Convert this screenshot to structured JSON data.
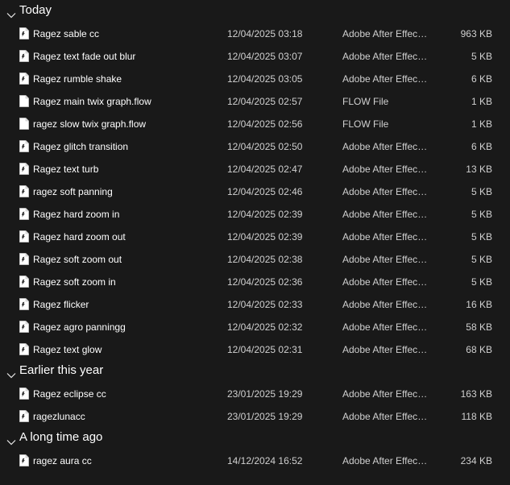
{
  "groups": [
    {
      "title": "Today",
      "files": [
        {
          "name": "Ragez sable cc",
          "date": "12/04/2025 03:18",
          "type": "Adobe After Effects Preset",
          "size": "963 KB",
          "icon": "ffx-icon"
        },
        {
          "name": "Ragez text fade out blur",
          "date": "12/04/2025 03:07",
          "type": "Adobe After Effects Preset",
          "size": "5 KB",
          "icon": "ffx-icon"
        },
        {
          "name": "Ragez rumble shake",
          "date": "12/04/2025 03:05",
          "type": "Adobe After Effects Preset",
          "size": "6 KB",
          "icon": "ffx-icon"
        },
        {
          "name": "Ragez main twix graph.flow",
          "date": "12/04/2025 02:57",
          "type": "FLOW File",
          "size": "1 KB",
          "icon": "file-icon"
        },
        {
          "name": "ragez slow twix graph.flow",
          "date": "12/04/2025 02:56",
          "type": "FLOW File",
          "size": "1 KB",
          "icon": "file-icon"
        },
        {
          "name": "Ragez glitch transition",
          "date": "12/04/2025 02:50",
          "type": "Adobe After Effects Preset",
          "size": "6 KB",
          "icon": "ffx-icon"
        },
        {
          "name": "Ragez text turb",
          "date": "12/04/2025 02:47",
          "type": "Adobe After Effects Preset",
          "size": "13 KB",
          "icon": "ffx-icon"
        },
        {
          "name": "ragez soft panning",
          "date": "12/04/2025 02:46",
          "type": "Adobe After Effects Preset",
          "size": "5 KB",
          "icon": "ffx-icon"
        },
        {
          "name": "Ragez hard zoom in",
          "date": "12/04/2025 02:39",
          "type": "Adobe After Effects Preset",
          "size": "5 KB",
          "icon": "ffx-icon"
        },
        {
          "name": "Ragez hard zoom out",
          "date": "12/04/2025 02:39",
          "type": "Adobe After Effects Preset",
          "size": "5 KB",
          "icon": "ffx-icon"
        },
        {
          "name": "Ragez soft zoom out",
          "date": "12/04/2025 02:38",
          "type": "Adobe After Effects Preset",
          "size": "5 KB",
          "icon": "ffx-icon"
        },
        {
          "name": "Ragez soft zoom in",
          "date": "12/04/2025 02:36",
          "type": "Adobe After Effects Preset",
          "size": "5 KB",
          "icon": "ffx-icon"
        },
        {
          "name": "Ragez flicker",
          "date": "12/04/2025 02:33",
          "type": "Adobe After Effects Preset",
          "size": "16 KB",
          "icon": "ffx-icon"
        },
        {
          "name": "Ragez agro panningg",
          "date": "12/04/2025 02:32",
          "type": "Adobe After Effects Preset",
          "size": "58 KB",
          "icon": "ffx-icon"
        },
        {
          "name": "Ragez text glow",
          "date": "12/04/2025 02:31",
          "type": "Adobe After Effects Preset",
          "size": "68 KB",
          "icon": "ffx-icon"
        }
      ]
    },
    {
      "title": "Earlier this year",
      "files": [
        {
          "name": "Ragez eclipse cc",
          "date": "23/01/2025 19:29",
          "type": "Adobe After Effects Preset",
          "size": "163 KB",
          "icon": "ffx-icon"
        },
        {
          "name": "ragezlunacc",
          "date": "23/01/2025 19:29",
          "type": "Adobe After Effects Preset",
          "size": "118 KB",
          "icon": "ffx-icon"
        }
      ]
    },
    {
      "title": "A long time ago",
      "files": [
        {
          "name": "ragez aura cc",
          "date": "14/12/2024 16:52",
          "type": "Adobe After Effects Preset",
          "size": "234 KB",
          "icon": "ffx-icon"
        }
      ]
    }
  ]
}
